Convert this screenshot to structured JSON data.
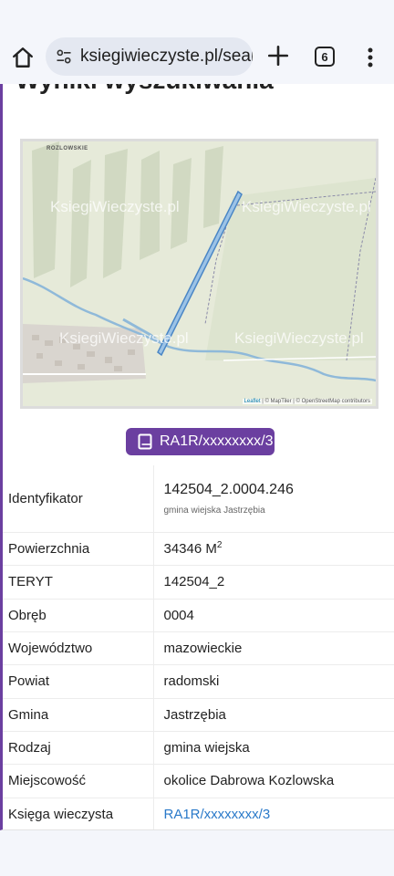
{
  "browser": {
    "url": "ksiegiwieczyste.pl/searc",
    "tab_count": "6",
    "icons": {
      "home": "home-icon",
      "site_info": "tune-icon",
      "new_tab": "plus-icon",
      "menu": "more-vert-icon"
    }
  },
  "page": {
    "heading": "Wyniki wyszukiwania",
    "map": {
      "top_label": "ROZLOWSKIE",
      "watermarks": [
        "KsiegiWieczyste.pl",
        "KsiegiWieczyste.pl",
        "KsiegiWieczyste.pl",
        "KsiegiWieczyste.pl"
      ],
      "attribution": {
        "leaflet": "Leaflet",
        "sep1": " | © MapTiler | © OpenStreetMap contributors"
      }
    },
    "kw_badge": {
      "label": "RA1R/xxxxxxxx/3",
      "icon": "book-icon"
    },
    "rows": [
      {
        "key": "Identyfikator",
        "value": "142504_2.0004.246",
        "sub": "gmina wiejska Jastrzębia"
      },
      {
        "key": "Powierzchnia",
        "value": "34346 M",
        "sup": "2"
      },
      {
        "key": "TERYT",
        "value": "142504_2"
      },
      {
        "key": "Obręb",
        "value": "0004"
      },
      {
        "key": "Województwo",
        "value": "mazowieckie"
      },
      {
        "key": "Powiat",
        "value": "radomski"
      },
      {
        "key": "Gmina",
        "value": "Jastrzębia"
      },
      {
        "key": "Rodzaj",
        "value": "gmina wiejska"
      },
      {
        "key": "Miejscowość",
        "value": "okolice Dabrowa Kozlowska"
      },
      {
        "key": "Księga wieczysta",
        "value": "RA1R/xxxxxxxx/3"
      }
    ],
    "colors": {
      "accent": "#6b3fa0",
      "link": "#2979c9",
      "parcel": "#6fa8dc"
    }
  }
}
